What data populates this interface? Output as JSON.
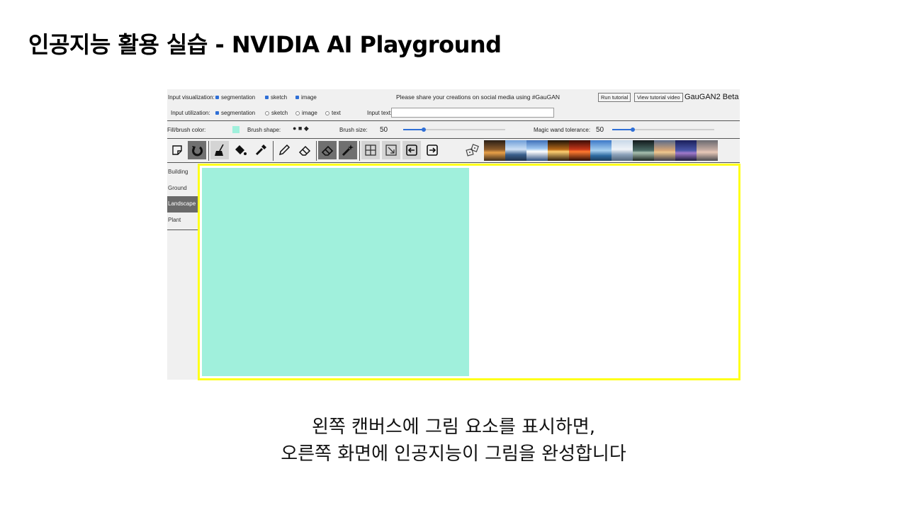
{
  "slide": {
    "title": "인공지능 활용 실습 - NVIDIA AI Playground",
    "caption_line1": "왼쪽 캔버스에 그림 요소를 표시하면,",
    "caption_line2": "오른쪽 화면에 인공지능이 그림을 완성합니다"
  },
  "app": {
    "title": "GauGAN2 Beta",
    "share_text": "Please share your creations on social media using #GauGAN",
    "run_tutorial": "Run tutorial",
    "view_tutorial_video": "View tutorial video",
    "input_visualization": {
      "label": "Input visualization:",
      "options": [
        {
          "label": "segmentation",
          "checked": true
        },
        {
          "label": "sketch",
          "checked": true
        },
        {
          "label": "image",
          "checked": true
        }
      ]
    },
    "input_utilization": {
      "label": "Input utilization:",
      "options": [
        {
          "label": "segmentation",
          "checked": true
        },
        {
          "label": "sketch",
          "checked": false
        },
        {
          "label": "image",
          "checked": false
        },
        {
          "label": "text",
          "checked": false
        }
      ],
      "input_text_label": "Input text:",
      "input_text_value": ""
    },
    "brush": {
      "fill_label": "Fill/brush color:",
      "fill_color": "#a0f0dc",
      "shape_label": "Brush shape:",
      "shapes": "● ■ ◆",
      "size_label": "Brush size:",
      "size_value": "50",
      "size_fraction": 0.2,
      "magic_label": "Magic wand tolerance:",
      "magic_value": "50",
      "magic_fraction": 0.2
    },
    "tools": [
      {
        "name": "new-canvas-icon"
      },
      {
        "name": "undo-icon"
      },
      {
        "name": "brush-icon"
      },
      {
        "name": "paint-bucket-icon"
      },
      {
        "name": "dropper-icon"
      },
      {
        "name": "pencil-icon"
      },
      {
        "name": "sketch-eraser-icon"
      },
      {
        "name": "eraser-icon"
      },
      {
        "name": "magic-wand-icon"
      },
      {
        "name": "layout-icon"
      },
      {
        "name": "download-icon"
      },
      {
        "name": "arrow-left-icon"
      },
      {
        "name": "arrow-right-icon"
      },
      {
        "name": "dice-icon"
      }
    ],
    "sidebar": {
      "items": [
        {
          "label": "Building",
          "active": false
        },
        {
          "label": "Ground",
          "active": false
        },
        {
          "label": "Landscape",
          "active": true
        },
        {
          "label": "Plant",
          "active": false
        }
      ]
    },
    "canvas": {
      "left_fill": "#a0f0dc",
      "frame_color": "#ffff1a"
    }
  }
}
